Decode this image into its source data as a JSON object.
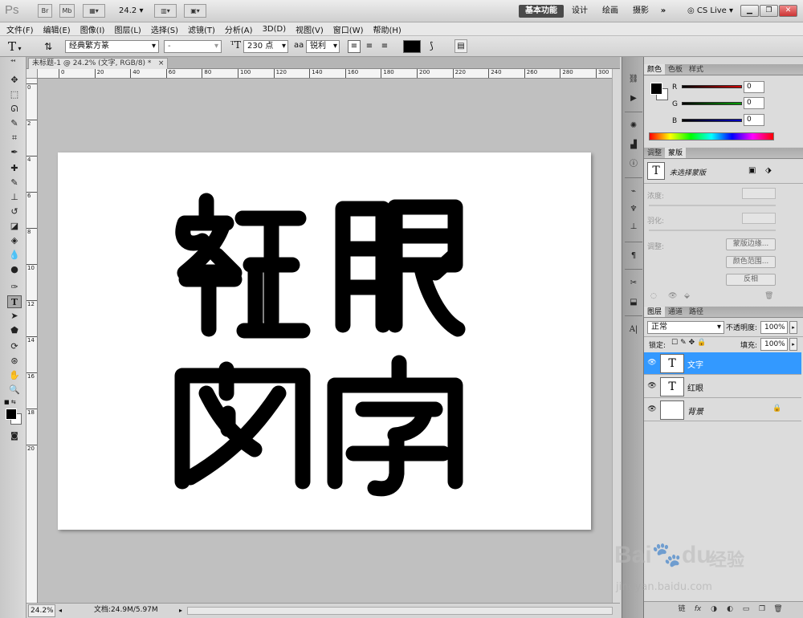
{
  "appbar": {
    "logo": "Ps",
    "bridge": "Br",
    "minibridge": "Mb",
    "zoom": "24.2",
    "workspaces": [
      "基本功能",
      "设计",
      "绘画",
      "摄影"
    ],
    "more": "»",
    "cslive": "CS Live"
  },
  "menu": [
    "文件(F)",
    "编辑(E)",
    "图像(I)",
    "图层(L)",
    "选择(S)",
    "滤镜(T)",
    "分析(A)",
    "3D(D)",
    "视图(V)",
    "窗口(W)",
    "帮助(H)"
  ],
  "options": {
    "tool_glyph": "T",
    "font_family": "经典繁方篆",
    "font_style": "-",
    "font_size": "230 点",
    "aa_prefix": "a",
    "aa_mode": "锐利",
    "text_color": "#000000"
  },
  "document": {
    "tab_title": "未标题-1 @ 24.2% (文字, RGB/8) *",
    "tab_close": "×",
    "ruler_h": [
      "0",
      "20",
      "40",
      "60",
      "80",
      "100",
      "120",
      "140",
      "160",
      "180",
      "200",
      "220",
      "240",
      "260",
      "280",
      "300"
    ],
    "ruler_v": [
      "0",
      "2",
      "4",
      "6",
      "8",
      "10",
      "12",
      "14",
      "16",
      "18",
      "20"
    ],
    "canvas_text": [
      "紅",
      "眼",
      "文",
      "字"
    ],
    "zoom_status": "24.2%",
    "doc_size": "文档:24.9M/5.97M"
  },
  "color_panel": {
    "tabs": [
      "颜色",
      "色板",
      "样式"
    ],
    "channels": [
      {
        "label": "R",
        "value": "0",
        "color": "#d40000"
      },
      {
        "label": "G",
        "value": "0",
        "color": "#00a000"
      },
      {
        "label": "B",
        "value": "0",
        "color": "#0000c8"
      }
    ]
  },
  "mask_panel": {
    "tabs": [
      "调整",
      "蒙版"
    ],
    "title": "未选择蒙版",
    "density": "浓度:",
    "feather": "羽化:",
    "adjust": "调整:",
    "buttons": [
      "蒙版边缘...",
      "颜色范围...",
      "反相"
    ]
  },
  "layers_panel": {
    "tabs": [
      "图层",
      "通道",
      "路径"
    ],
    "blend": "正常",
    "opacity_label": "不透明度:",
    "opacity": "100%",
    "lock_label": "锁定:",
    "fill_label": "填充:",
    "fill": "100%",
    "layers": [
      {
        "name": "文字",
        "type": "T",
        "selected": true
      },
      {
        "name": "红眼",
        "type": "T",
        "selected": false
      },
      {
        "name": "背景",
        "type": "",
        "selected": false
      }
    ],
    "bottom_icons": [
      "链",
      "fx",
      "◑",
      "◐",
      "▭",
      "❐",
      "🗑"
    ]
  },
  "watermark": {
    "brand": "Bai",
    "brand2": "du",
    "cn": "经验",
    "url": "jingyan.baidu.com"
  },
  "colors": {
    "selection": "#3399ff",
    "workspace_active": "#4a4a4a"
  }
}
